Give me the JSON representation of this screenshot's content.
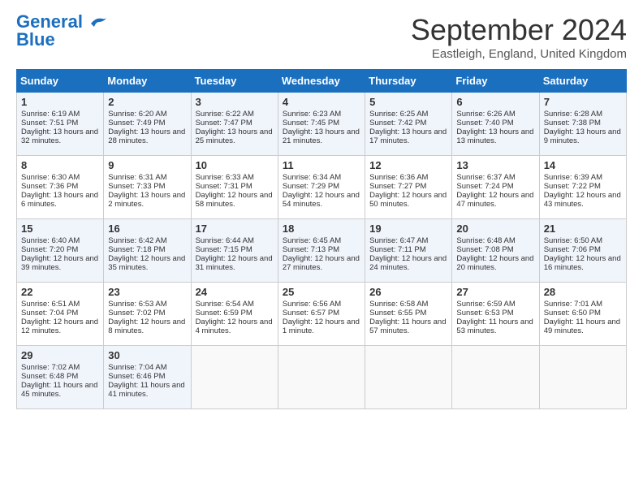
{
  "header": {
    "logo_general": "General",
    "logo_blue": "Blue",
    "month_title": "September 2024",
    "location": "Eastleigh, England, United Kingdom"
  },
  "days_of_week": [
    "Sunday",
    "Monday",
    "Tuesday",
    "Wednesday",
    "Thursday",
    "Friday",
    "Saturday"
  ],
  "weeks": [
    [
      {
        "day": "1",
        "info": "Sunrise: 6:19 AM\nSunset: 7:51 PM\nDaylight: 13 hours and 32 minutes."
      },
      {
        "day": "2",
        "info": "Sunrise: 6:20 AM\nSunset: 7:49 PM\nDaylight: 13 hours and 28 minutes."
      },
      {
        "day": "3",
        "info": "Sunrise: 6:22 AM\nSunset: 7:47 PM\nDaylight: 13 hours and 25 minutes."
      },
      {
        "day": "4",
        "info": "Sunrise: 6:23 AM\nSunset: 7:45 PM\nDaylight: 13 hours and 21 minutes."
      },
      {
        "day": "5",
        "info": "Sunrise: 6:25 AM\nSunset: 7:42 PM\nDaylight: 13 hours and 17 minutes."
      },
      {
        "day": "6",
        "info": "Sunrise: 6:26 AM\nSunset: 7:40 PM\nDaylight: 13 hours and 13 minutes."
      },
      {
        "day": "7",
        "info": "Sunrise: 6:28 AM\nSunset: 7:38 PM\nDaylight: 13 hours and 9 minutes."
      }
    ],
    [
      {
        "day": "8",
        "info": "Sunrise: 6:30 AM\nSunset: 7:36 PM\nDaylight: 13 hours and 6 minutes."
      },
      {
        "day": "9",
        "info": "Sunrise: 6:31 AM\nSunset: 7:33 PM\nDaylight: 13 hours and 2 minutes."
      },
      {
        "day": "10",
        "info": "Sunrise: 6:33 AM\nSunset: 7:31 PM\nDaylight: 12 hours and 58 minutes."
      },
      {
        "day": "11",
        "info": "Sunrise: 6:34 AM\nSunset: 7:29 PM\nDaylight: 12 hours and 54 minutes."
      },
      {
        "day": "12",
        "info": "Sunrise: 6:36 AM\nSunset: 7:27 PM\nDaylight: 12 hours and 50 minutes."
      },
      {
        "day": "13",
        "info": "Sunrise: 6:37 AM\nSunset: 7:24 PM\nDaylight: 12 hours and 47 minutes."
      },
      {
        "day": "14",
        "info": "Sunrise: 6:39 AM\nSunset: 7:22 PM\nDaylight: 12 hours and 43 minutes."
      }
    ],
    [
      {
        "day": "15",
        "info": "Sunrise: 6:40 AM\nSunset: 7:20 PM\nDaylight: 12 hours and 39 minutes."
      },
      {
        "day": "16",
        "info": "Sunrise: 6:42 AM\nSunset: 7:18 PM\nDaylight: 12 hours and 35 minutes."
      },
      {
        "day": "17",
        "info": "Sunrise: 6:44 AM\nSunset: 7:15 PM\nDaylight: 12 hours and 31 minutes."
      },
      {
        "day": "18",
        "info": "Sunrise: 6:45 AM\nSunset: 7:13 PM\nDaylight: 12 hours and 27 minutes."
      },
      {
        "day": "19",
        "info": "Sunrise: 6:47 AM\nSunset: 7:11 PM\nDaylight: 12 hours and 24 minutes."
      },
      {
        "day": "20",
        "info": "Sunrise: 6:48 AM\nSunset: 7:08 PM\nDaylight: 12 hours and 20 minutes."
      },
      {
        "day": "21",
        "info": "Sunrise: 6:50 AM\nSunset: 7:06 PM\nDaylight: 12 hours and 16 minutes."
      }
    ],
    [
      {
        "day": "22",
        "info": "Sunrise: 6:51 AM\nSunset: 7:04 PM\nDaylight: 12 hours and 12 minutes."
      },
      {
        "day": "23",
        "info": "Sunrise: 6:53 AM\nSunset: 7:02 PM\nDaylight: 12 hours and 8 minutes."
      },
      {
        "day": "24",
        "info": "Sunrise: 6:54 AM\nSunset: 6:59 PM\nDaylight: 12 hours and 4 minutes."
      },
      {
        "day": "25",
        "info": "Sunrise: 6:56 AM\nSunset: 6:57 PM\nDaylight: 12 hours and 1 minute."
      },
      {
        "day": "26",
        "info": "Sunrise: 6:58 AM\nSunset: 6:55 PM\nDaylight: 11 hours and 57 minutes."
      },
      {
        "day": "27",
        "info": "Sunrise: 6:59 AM\nSunset: 6:53 PM\nDaylight: 11 hours and 53 minutes."
      },
      {
        "day": "28",
        "info": "Sunrise: 7:01 AM\nSunset: 6:50 PM\nDaylight: 11 hours and 49 minutes."
      }
    ],
    [
      {
        "day": "29",
        "info": "Sunrise: 7:02 AM\nSunset: 6:48 PM\nDaylight: 11 hours and 45 minutes."
      },
      {
        "day": "30",
        "info": "Sunrise: 7:04 AM\nSunset: 6:46 PM\nDaylight: 11 hours and 41 minutes."
      },
      {
        "day": "",
        "info": ""
      },
      {
        "day": "",
        "info": ""
      },
      {
        "day": "",
        "info": ""
      },
      {
        "day": "",
        "info": ""
      },
      {
        "day": "",
        "info": ""
      }
    ]
  ]
}
